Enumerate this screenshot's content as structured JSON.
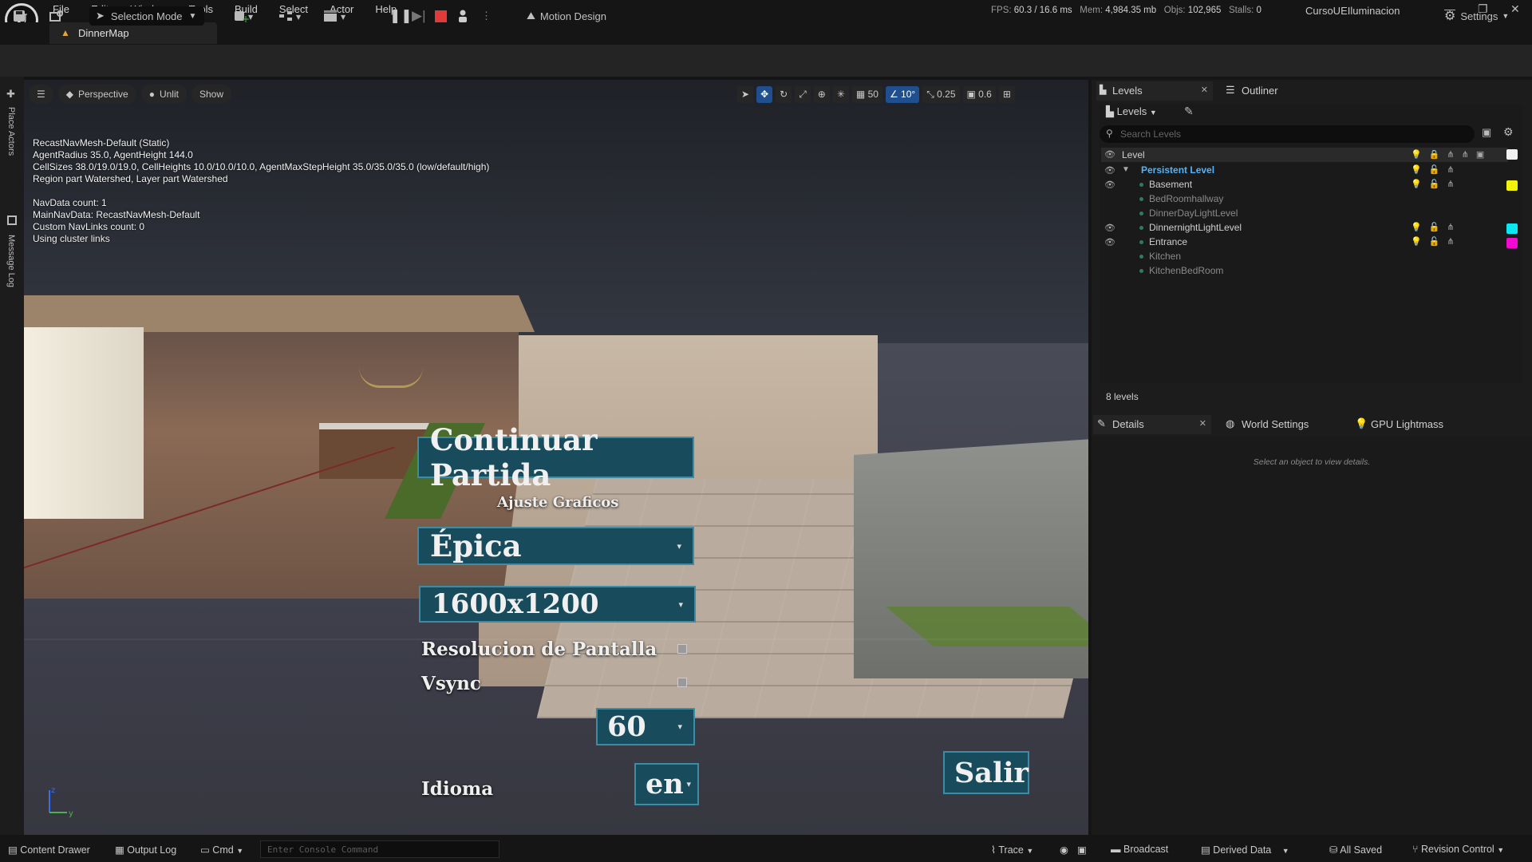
{
  "app": {
    "logo_text": "U",
    "menus": [
      "File",
      "Edit",
      "Window",
      "Tools",
      "Build",
      "Select",
      "Actor",
      "Help"
    ],
    "stats": {
      "fps_label": "FPS:",
      "fps": "60.3",
      "ms": "/ 16.6 ms",
      "mem_label": "Mem:",
      "mem": "4,984.35 mb",
      "objs_label": "Objs:",
      "objs": "102,965",
      "stalls_label": "Stalls:",
      "stalls": "0"
    },
    "project": "CursoUEIluminacion",
    "window_controls": [
      "—",
      "❐",
      "✕"
    ]
  },
  "document_tab": "DinnerMap",
  "toolbar": {
    "selection_mode": "Selection Mode",
    "motion_design": "Motion Design",
    "settings": "Settings"
  },
  "left_rail": {
    "place_actors": "Place Actors",
    "message_log": "Message Log"
  },
  "viewport": {
    "view_mode": "Perspective",
    "lighting_mode": "Unlit",
    "show_label": "Show",
    "grid_size": "50",
    "rotation_snap": "10°",
    "scale_snap": "0.25",
    "camera_speed": "0.6",
    "debug_text": "RecastNavMesh-Default (Static)\nAgentRadius 35.0, AgentHeight 144.0\nCellSizes 38.0/19.0/19.0, CellHeights 10.0/10.0/10.0, AgentMaxStepHeight 35.0/35.0/35.0 (low/default/high)\nRegion part Watershed, Layer part Watershed\n\nNavData count: 1\nMainNavData: RecastNavMesh-Default\nCustom NavLinks count: 0\nUsing cluster links",
    "axis_labels": {
      "z": "z",
      "y": "y"
    }
  },
  "game_menu": {
    "continue_button": "Continuar Partida",
    "graphics_label": "Ajuste Graficos",
    "quality_value": "Épica",
    "resolution_value": "1600x1200",
    "screen_resolution_label": "Resolucion de Pantalla",
    "vsync_label": "Vsync",
    "fps_value": "60",
    "language_label": "Idioma",
    "language_value": "en",
    "exit_button": "Salir"
  },
  "levels_panel": {
    "tab_levels": "Levels",
    "tab_outliner": "Outliner",
    "levels_dropdown": "Levels",
    "search_placeholder": "Search Levels",
    "header": "Level",
    "rows": [
      {
        "name": "Persistent Level",
        "visible": true,
        "color": ""
      },
      {
        "name": "Basement",
        "visible": true,
        "color": "#f2f20a"
      },
      {
        "name": "BedRoomhallway",
        "visible": false,
        "color": ""
      },
      {
        "name": "DinnerDayLightLevel",
        "visible": false,
        "color": ""
      },
      {
        "name": "DinnernightLightLevel",
        "visible": true,
        "color": "#0ae6f2"
      },
      {
        "name": "Entrance",
        "visible": true,
        "color": "#f20ad2"
      },
      {
        "name": "Kitchen",
        "visible": false,
        "color": ""
      },
      {
        "name": "KitchenBedRoom",
        "visible": false,
        "color": ""
      }
    ],
    "count": "8 levels"
  },
  "details_panel": {
    "tab_details": "Details",
    "tab_world_settings": "World Settings",
    "tab_gpu_lightmass": "GPU Lightmass",
    "empty_message": "Select an object to view details."
  },
  "statusbar": {
    "content_drawer": "Content Drawer",
    "output_log": "Output Log",
    "cmd": "Cmd",
    "console_placeholder": "Enter Console Command",
    "trace": "Trace",
    "broadcast": "Broadcast",
    "derived_data": "Derived Data",
    "all_saved": "All Saved",
    "revision_control": "Revision Control"
  },
  "colors": {
    "accent": "#1f4f8f",
    "menu_button": "#184c5c",
    "persistent_level": "#4fb4ff"
  }
}
